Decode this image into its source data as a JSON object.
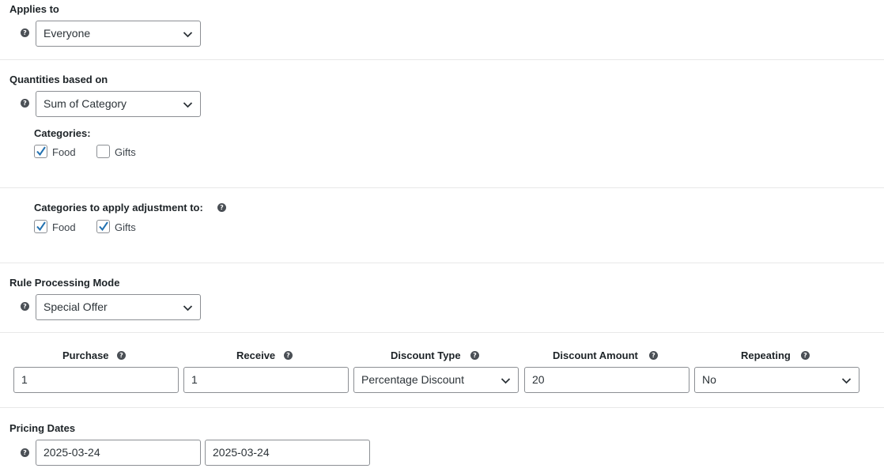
{
  "applies_to": {
    "label": "Applies to",
    "value": "Everyone"
  },
  "quantities": {
    "label": "Quantities based on",
    "value": "Sum of Category",
    "categories_label": "Categories:",
    "categories": [
      {
        "label": "Food",
        "checked": true
      },
      {
        "label": "Gifts",
        "checked": false
      }
    ]
  },
  "adjustment": {
    "label": "Categories to apply adjustment to:",
    "categories": [
      {
        "label": "Food",
        "checked": true
      },
      {
        "label": "Gifts",
        "checked": true
      }
    ]
  },
  "processing": {
    "label": "Rule Processing Mode",
    "value": "Special Offer"
  },
  "offer": {
    "headers": {
      "purchase": "Purchase",
      "receive": "Receive",
      "discount_type": "Discount Type",
      "discount_amount": "Discount Amount",
      "repeating": "Repeating"
    },
    "values": {
      "purchase": "1",
      "receive": "1",
      "discount_type": "Percentage Discount",
      "discount_amount": "20",
      "repeating": "No"
    }
  },
  "dates": {
    "label": "Pricing Dates",
    "from": "2025-03-24",
    "to": "2025-03-24"
  },
  "colors": {
    "checkmark": "#2271b1",
    "help_icon": "#4a4f55",
    "border": "#8c8f94"
  }
}
